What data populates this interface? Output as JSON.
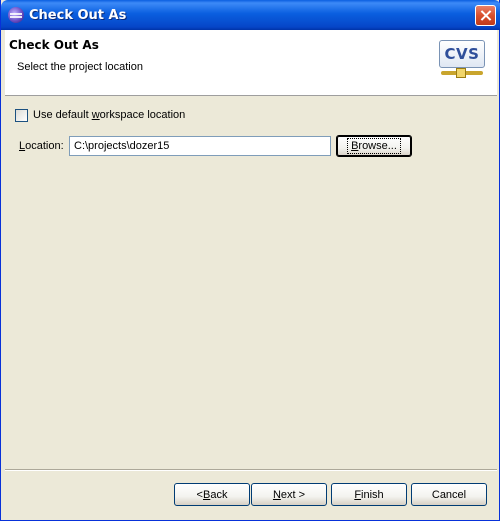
{
  "window": {
    "title": "Check Out As",
    "icon": "eclipse-icon",
    "close_icon": "close-icon"
  },
  "banner": {
    "title": "Check Out As",
    "subtitle": "Select the project location",
    "logo_text": "CVS",
    "logo_icon": "cvs-logo-icon"
  },
  "form": {
    "use_default": {
      "label_pre": "Use default ",
      "label_mnemonic": "w",
      "label_post": "orkspace location",
      "checked": false
    },
    "location": {
      "label_pre": "",
      "label_mnemonic": "L",
      "label_post": "ocation:",
      "value": "C:\\projects\\dozer15"
    },
    "browse": {
      "label_pre": "",
      "label_mnemonic": "B",
      "label_post": "rowse..."
    }
  },
  "footer": {
    "back": {
      "label_pre": "< ",
      "label_mnemonic": "B",
      "label_post": "ack"
    },
    "next": {
      "label_pre": "",
      "label_mnemonic": "N",
      "label_post": "ext >"
    },
    "finish": {
      "label_pre": "",
      "label_mnemonic": "F",
      "label_post": "inish"
    },
    "cancel": {
      "label": "Cancel"
    }
  }
}
